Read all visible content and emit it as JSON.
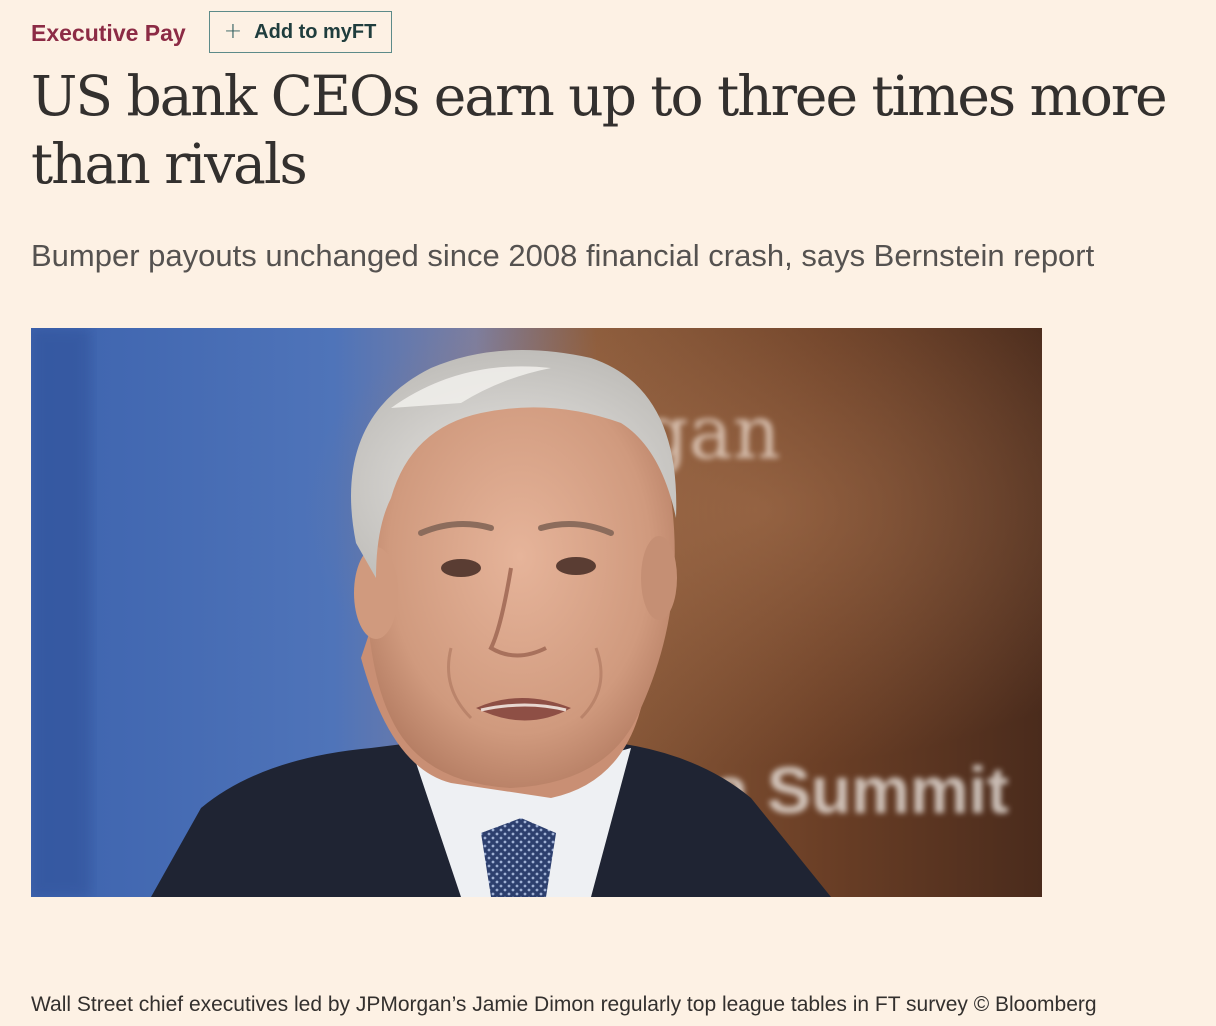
{
  "topic": {
    "label": "Executive Pay",
    "color": "#8c2b45"
  },
  "myft": {
    "icon": "plus-icon",
    "icon_glyph": "+",
    "label": "Add to myFT"
  },
  "article": {
    "headline": "US bank CEOs earn up to three times more than rivals",
    "standfirst": "Bumper payouts unchanged since 2008 financial crash, says Bernstein report",
    "image": {
      "backdrop_text_top": "organ",
      "backdrop_text_bottom": "ina Summit"
    },
    "caption": "Wall Street chief executives led by JPMorgan’s Jamie Dimon regularly top league tables in FT survey © Bloomberg"
  },
  "colors": {
    "background": "#fdf1e4",
    "headline": "#33302e",
    "button_border": "#5d8b89"
  }
}
